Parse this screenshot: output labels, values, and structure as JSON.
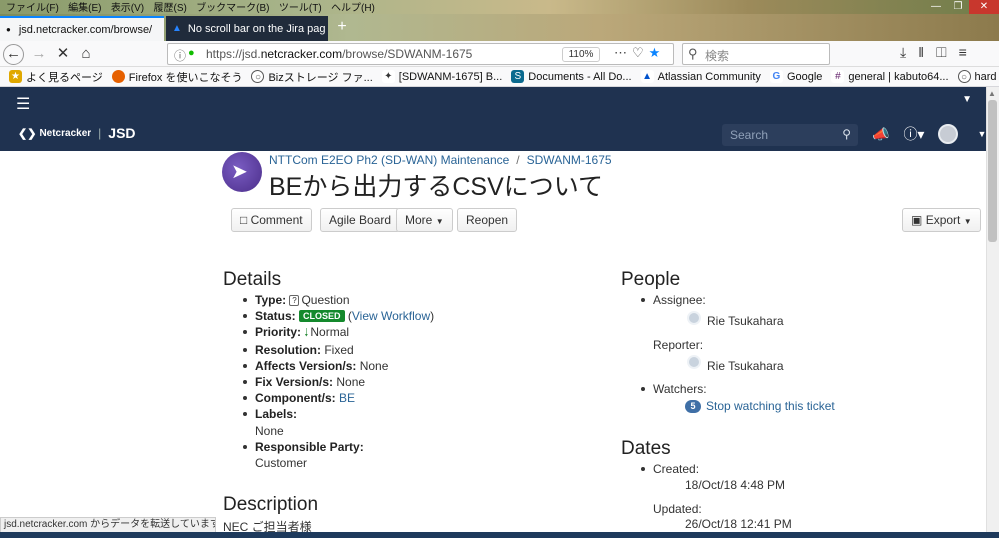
{
  "browser": {
    "menu": [
      "ファイル(F)",
      "編集(E)",
      "表示(V)",
      "履歴(S)",
      "ブックマーク(B)",
      "ツール(T)",
      "ヘルプ(H)"
    ],
    "tabs": [
      {
        "title": "jsd.netcracker.com/browse/",
        "close": "×"
      },
      {
        "title": "No scroll bar on the Jira pag",
        "close": "×"
      }
    ],
    "new_tab": "+",
    "url_prefix": "https://jsd.",
    "url_host": "netcracker.com",
    "url_path": "/browse/SDWANM-1675",
    "zoom": "110%",
    "search_placeholder": "検索",
    "bookmarks": [
      {
        "label": "よく見るページ",
        "icon": "star-icon",
        "color": "#e0a800"
      },
      {
        "label": "Firefox を使いこなそう",
        "icon": "firefox-icon",
        "color": "#e66000"
      },
      {
        "label": "Bizストレージ ファ...",
        "icon": "globe-icon",
        "color": "#555555"
      },
      {
        "label": "[SDWANM-1675] B...",
        "icon": "jira-icon",
        "color": "#333333"
      },
      {
        "label": "Documents - All Do...",
        "icon": "sharepoint-icon",
        "color": "#0b6a8e"
      },
      {
        "label": "Atlassian Community",
        "icon": "atlassian-icon",
        "color": "#0052cc"
      },
      {
        "label": "Google",
        "icon": "google-icon",
        "color": "#4285f4"
      },
      {
        "label": "general | kabuto64...",
        "icon": "slack-icon",
        "color": "#611f69"
      },
      {
        "label": "hard refresh in Chr...",
        "icon": "globe-icon",
        "color": "#555555"
      }
    ],
    "status_text": "jsd.netcracker.com からデータを転送しています..."
  },
  "header": {
    "brand": "Netcracker",
    "product": "JSD",
    "search_placeholder": "Search"
  },
  "issue": {
    "project": "NTTCom E2EO Ph2 (SD-WAN) Maintenance",
    "key": "SDWANM-1675",
    "title": "BEから出力するCSVについて",
    "actions": {
      "comment": "Comment",
      "agile": "Agile Board",
      "more": "More",
      "reopen": "Reopen",
      "export": "Export"
    }
  },
  "details": {
    "heading": "Details",
    "type_label": "Type:",
    "type": "Question",
    "status_label": "Status:",
    "status": "CLOSED",
    "view_workflow": "View Workflow",
    "priority_label": "Priority:",
    "priority": "Normal",
    "resolution_label": "Resolution:",
    "resolution": "Fixed",
    "affects_label": "Affects Version/s:",
    "affects": "None",
    "fix_label": "Fix Version/s:",
    "fix": "None",
    "component_label": "Component/s:",
    "component": "BE",
    "labels_label": "Labels:",
    "labels": "None",
    "party_label": "Responsible Party:",
    "party": "Customer"
  },
  "description": {
    "heading": "Description",
    "text": "NEC ご担当者様"
  },
  "people": {
    "heading": "People",
    "assignee_label": "Assignee:",
    "assignee": "Rie Tsukahara",
    "reporter_label": "Reporter:",
    "reporter": "Rie Tsukahara",
    "watchers_label": "Watchers:",
    "watch_count": "5",
    "stop_watching": "Stop watching this ticket"
  },
  "dates": {
    "heading": "Dates",
    "created_label": "Created:",
    "created": "18/Oct/18 4:48 PM",
    "updated_label": "Updated:",
    "updated": "26/Oct/18 12:41 PM"
  }
}
